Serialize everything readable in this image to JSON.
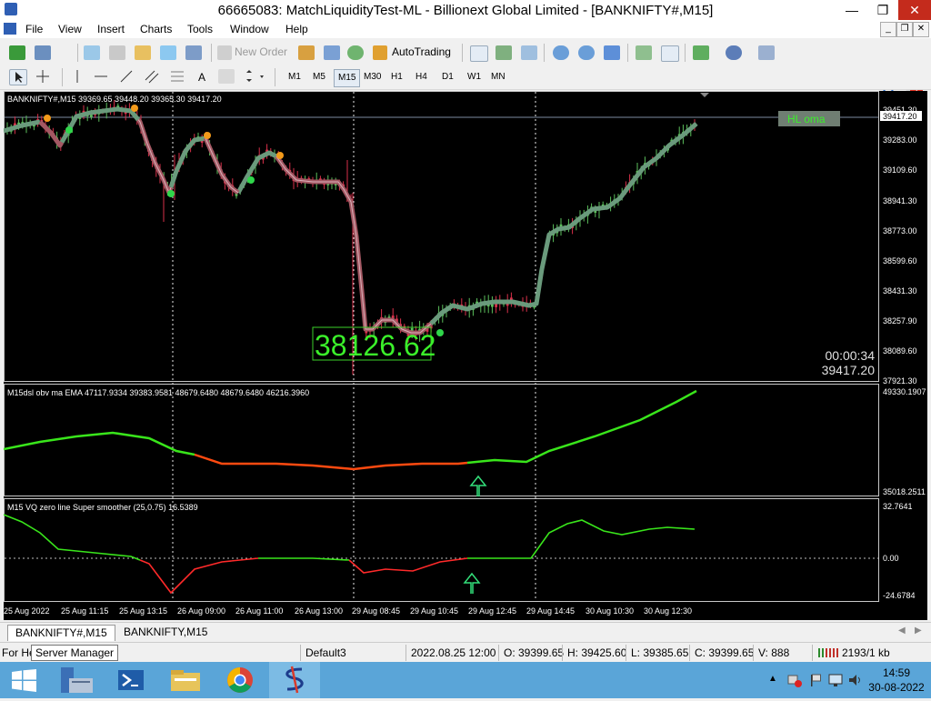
{
  "window": {
    "title": "66665083: MatchLiquidityTest-ML - Billionext Global Limited - [BANKNIFTY#,M15]"
  },
  "menu": [
    "File",
    "View",
    "Insert",
    "Charts",
    "Tools",
    "Window",
    "Help"
  ],
  "toolbar": {
    "new_order": "New Order",
    "autotrading": "AutoTrading"
  },
  "timeframes": [
    "M1",
    "M5",
    "M15",
    "M30",
    "H1",
    "H4",
    "D1",
    "W1",
    "MN"
  ],
  "active_timeframe": "M15",
  "main_chart": {
    "header": "BANKNIFTY#,M15  39369.65 39448.20 39365.30 39417.20",
    "price_labels": [
      "39451.30",
      "39283.00",
      "39109.60",
      "38941.30",
      "38773.00",
      "38599.60",
      "38431.30",
      "38257.90",
      "38089.60",
      "37921.30"
    ],
    "current_price": "39417.20",
    "big_label": "38126.62",
    "hl_label": "HL oma",
    "countdown": "00:00:34",
    "last_price": "39417.20"
  },
  "indicator1": {
    "header": "M15dsl  obv ma  EMA  47117.9334 39383.9581 48679.6480 48679.6480 46216.3960",
    "top_label": "49330.1907",
    "bottom_label": "35018.2511"
  },
  "indicator2": {
    "header": "M15 VQ zero line Super smoother (25,0.75) 16.5389",
    "top_label": "32.7641",
    "zero_label": "0.00",
    "bottom_label": "-24.6784"
  },
  "time_axis": [
    "25 Aug 2022",
    "25 Aug 11:15",
    "25 Aug 13:15",
    "26 Aug 09:00",
    "26 Aug 11:00",
    "26 Aug 13:00",
    "29 Aug 08:45",
    "29 Aug 10:45",
    "29 Aug 12:45",
    "29 Aug 14:45",
    "30 Aug 10:30",
    "30 Aug 12:30"
  ],
  "tabs": [
    "BANKNIFTY#,M15",
    "BANKNIFTY,M15"
  ],
  "status": {
    "left": "For He",
    "tooltip": "Server Manager",
    "profile": "Default3",
    "datetime": "2022.08.25 12:00",
    "open": "O: 39399.65",
    "high": "H: 39425.60",
    "low": "L: 39385.65",
    "close": "C: 39399.65",
    "volume": "V: 888",
    "traffic": "2193/1 kb"
  },
  "taskbar": {
    "time": "14:59",
    "date": "30-08-2022"
  },
  "notification_badge": "1",
  "colors": {
    "green_line": "#39e51b",
    "red_line": "#ff4a10",
    "bull_candle": "#5cbf5c",
    "bear_candle": "#d9304a",
    "ma_green": "#6a9a7c",
    "ma_red": "#a35863"
  }
}
